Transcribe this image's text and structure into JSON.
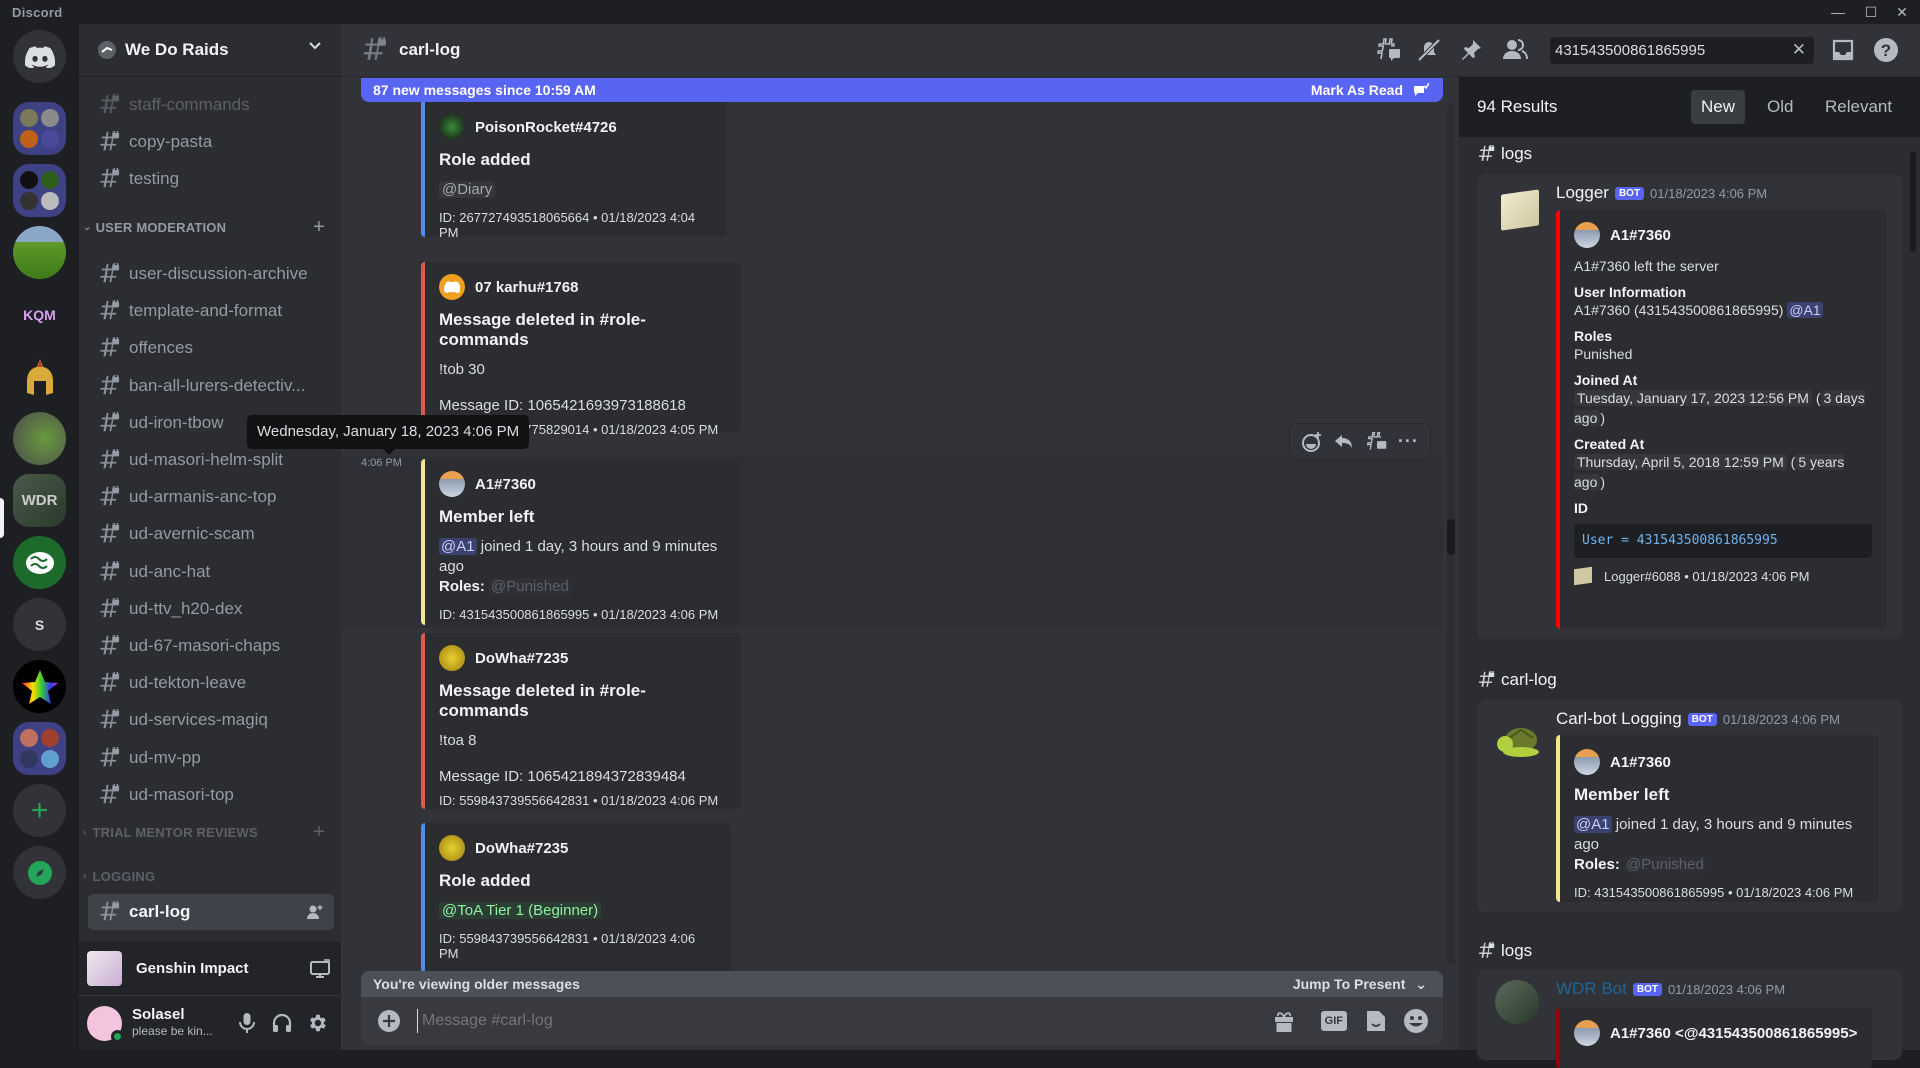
{
  "window": {
    "app_name": "Discord",
    "minimize": "—",
    "maximize": "☐",
    "close": "✕"
  },
  "guilds": [
    {
      "name": "Direct Messages",
      "icon": "discord-logo-icon"
    },
    {
      "name": "Server folder 1",
      "icon": "folder-icon",
      "colors": [
        "#7a7a5a",
        "#8a8a8a",
        "#c0601a",
        "#4a4a9a"
      ]
    },
    {
      "name": "Server folder 2",
      "icon": "folder-icon",
      "colors": [
        "#111111",
        "#2f5f1f",
        "#333333",
        "#bbbbbb"
      ]
    },
    {
      "name": "Cornfield server",
      "icon": "cornfield-icon"
    },
    {
      "name": "KQM server",
      "icon": "kqm-icon",
      "label": "KQM"
    },
    {
      "name": "Helmet server",
      "icon": "helmet-icon"
    },
    {
      "name": "Berries server",
      "icon": "berries-icon"
    },
    {
      "name": "We Do Raids",
      "icon": "wdr-icon",
      "label": "WDR",
      "selected": true
    },
    {
      "name": "Brain server",
      "icon": "brain-icon"
    },
    {
      "name": "S",
      "icon": "letter-icon",
      "label": "S"
    },
    {
      "name": "Rainbow star server",
      "icon": "star-icon"
    },
    {
      "name": "Server folder 3",
      "icon": "folder-icon",
      "colors": [
        "#c07060",
        "#a04030",
        "#303860",
        "#60a0d0"
      ]
    },
    {
      "name": "Add a Server",
      "icon": "plus-icon",
      "label": "+"
    },
    {
      "name": "Explore Discoverable Servers",
      "icon": "compass-icon"
    }
  ],
  "server": {
    "name": "We Do Raids",
    "chevron": "⌄"
  },
  "channels_top": [
    "staff-commands",
    "copy-pasta",
    "testing"
  ],
  "categories": {
    "user_moderation": "USER MODERATION",
    "trial_mentor_reviews": "TRIAL MENTOR REVIEWS",
    "logging": "LOGGING"
  },
  "channels_user_moderation": [
    "user-discussion-archive",
    "template-and-format",
    "offences",
    "ban-all-lurers-detectiv...",
    "ud-iron-tbow",
    "ud-masori-helm-split",
    "ud-armanis-anc-top",
    "ud-avernic-scam",
    "ud-anc-hat",
    "ud-ttv_h20-dex",
    "ud-67-masori-chaps",
    "ud-tekton-leave",
    "ud-services-magiq",
    "ud-mv-pp",
    "ud-masori-top"
  ],
  "channels_logging": [
    {
      "name": "carl-log",
      "active": true
    }
  ],
  "activity": {
    "name": "Genshin Impact"
  },
  "user": {
    "name": "Solasel",
    "status": "please be kin...",
    "presence_color": "#23a55a"
  },
  "header": {
    "channel": "carl-log",
    "search_value": "431543500861865995"
  },
  "new_messages_bar": {
    "text": "87 new messages since 10:59 AM",
    "mark_read": "Mark As Read"
  },
  "tooltip": "Wednesday, January 18, 2023 4:06 PM",
  "hover_timestamp": "4:06 PM",
  "messages": [
    {
      "author": "PoisonRocket#4726",
      "title": "Role added",
      "role": "@Diary",
      "footer": "ID: 267727493518065664 • 01/18/2023 4:04 PM",
      "color": "#4e8df0"
    },
    {
      "author": "07 karhu#1768",
      "title": "Message deleted in #role-commands",
      "content": "!tob 30",
      "message_id": "Message ID: 1065421693973188618",
      "footer": "ID: 386262461775829014 • 01/18/2023 4:05 PM",
      "color": "#e0584f"
    },
    {
      "author": "A1#7360",
      "title": "Member left",
      "mention": "@A1",
      "desc": " joined 1 day, 3 hours and 9 minutes ago",
      "roles_label": "Roles:",
      "role": "@Punished",
      "footer": "ID: 431543500861865995 • 01/18/2023 4:06 PM",
      "color": "#f5e58e"
    },
    {
      "author": "DoWha#7235",
      "title": "Message deleted in #role-commands",
      "content": "!toa 8",
      "message_id": "Message ID: 1065421894372839484",
      "footer": "ID: 559843739556642831 • 01/18/2023 4:06 PM",
      "color": "#e0584f"
    },
    {
      "author": "DoWha#7235",
      "title": "Role added",
      "role": "@ToA Tier 1 (Beginner)",
      "footer": "ID: 559843739556642831 • 01/18/2023 4:06 PM",
      "color": "#4e8df0"
    }
  ],
  "composer": {
    "older_text": "You're viewing older messages",
    "jump": "Jump To Present",
    "placeholder": "Message #carl-log",
    "gif": "GIF"
  },
  "search": {
    "count": "94 Results",
    "tabs": [
      "New",
      "Old",
      "Relevant"
    ],
    "active_tab": "New",
    "results": [
      {
        "channel": "logs",
        "bot": "Logger",
        "badge": "BOT",
        "time": "01/18/2023 4:06 PM",
        "embed_author": "A1#7360",
        "desc": "A1#7360 left the server",
        "fields": {
          "user_info_name": "User Information",
          "user_info_val": "A1#7360 (431543500861865995)",
          "user_info_mention": "@A1",
          "roles_name": "Roles",
          "roles_val": "Punished",
          "joined_name": "Joined At",
          "joined_val": "Tuesday, January 17, 2023 12:56 PM",
          "joined_rel": "3 days ago",
          "created_name": "Created At",
          "created_val": "Thursday, April 5, 2018 12:59 PM",
          "created_rel": "5 years ago",
          "id_name": "ID",
          "id_code": "User = 431543500861865995"
        },
        "footer": "Logger#6088 • 01/18/2023 4:06 PM"
      },
      {
        "channel": "carl-log",
        "bot": "Carl-bot Logging",
        "badge": "BOT",
        "time": "01/18/2023 4:06 PM",
        "embed_author": "A1#7360",
        "title": "Member left",
        "mention": "@A1",
        "desc": " joined 1 day, 3 hours and 9 minutes ago",
        "roles_label": "Roles:",
        "role": "@Punished",
        "footer": "ID: 431543500861865995 • 01/18/2023 4:06 PM"
      },
      {
        "channel": "logs",
        "bot": "WDR Bot",
        "badge": "BOT",
        "time": "01/18/2023 4:06 PM",
        "embed_author": "A1#7360  <@431543500861865995>"
      }
    ]
  }
}
